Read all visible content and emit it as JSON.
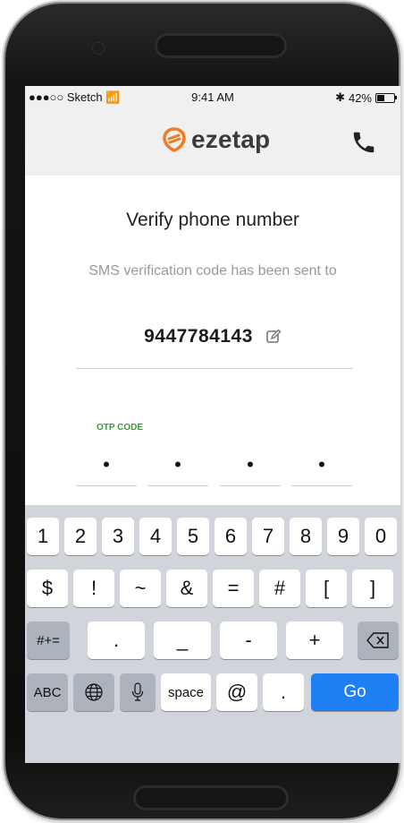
{
  "status_bar": {
    "carrier": "●●●○○ Sketch",
    "time": "9:41 AM",
    "battery_percent": "42%",
    "battery_level": 0.42
  },
  "header": {
    "logo_text": "ezetap",
    "logo_color": "#f27a22"
  },
  "verify": {
    "title": "Verify phone number",
    "subtitle": "SMS verification code has been sent to",
    "phone_number": "9447784143"
  },
  "otp": {
    "label": "OTP CODE",
    "label_color": "#3d9b35",
    "digits": [
      "•",
      "•",
      "•",
      "•"
    ]
  },
  "keyboard": {
    "row1": [
      "1",
      "2",
      "3",
      "4",
      "5",
      "6",
      "7",
      "8",
      "9",
      "0"
    ],
    "row2": [
      "$",
      "!",
      "~",
      "&",
      "=",
      "#",
      "[",
      "]"
    ],
    "row3": {
      "toggle": "#+=",
      "keys": [
        ".",
        "_",
        "-",
        "+"
      ]
    },
    "row4": {
      "abc": "ABC",
      "space": "space",
      "at": "@",
      "dot": ".",
      "go": "Go"
    },
    "accent_color": "#1f7ff5"
  }
}
